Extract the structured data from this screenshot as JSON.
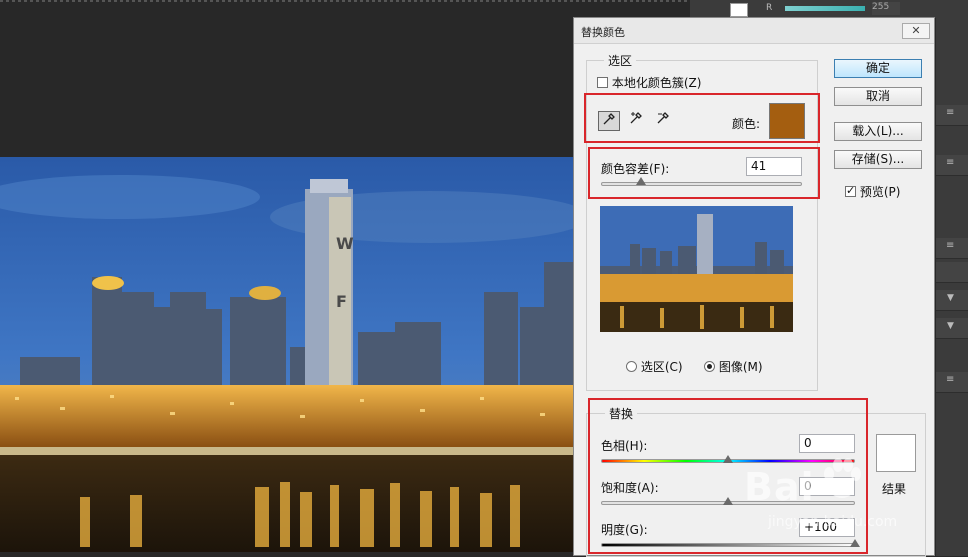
{
  "dialog": {
    "title": "替换颜色",
    "close_label": "✕",
    "selection": {
      "legend": "选区",
      "localized_label": "本地化颜色簇(Z)",
      "localized_checked": false,
      "tools": [
        "eyedropper-icon",
        "eyedropper-plus-icon",
        "eyedropper-minus-icon"
      ],
      "color_label": "颜色:",
      "color_value": "#a45e10",
      "tolerance_label": "颜色容差(F):",
      "tolerance_value": "41",
      "tolerance_level": 0.2,
      "view_selection_label": "选区(C)",
      "view_image_label": "图像(M)",
      "view_selected": "image"
    },
    "replace": {
      "legend": "替换",
      "hue_label": "色相(H):",
      "hue_value": "0",
      "hue_level": 0.5,
      "saturation_label": "饱和度(A):",
      "saturation_value": "0",
      "saturation_level": 0.5,
      "lightness_label": "明度(G):",
      "lightness_value": "+100",
      "lightness_level": 1.0,
      "result_label": "结果",
      "result_color": "#ffffff"
    },
    "buttons": {
      "ok": "确定",
      "cancel": "取消",
      "load": "载入(L)...",
      "save": "存储(S)..."
    },
    "preview_label": "预览(P)",
    "preview_checked": true
  },
  "topbar": {
    "channel_label": "R",
    "channel_value": "255"
  },
  "watermark": {
    "brand": "Bai",
    "domain": "jingyan.baidu.com"
  },
  "colors": {
    "highlight_box": "#d9262b",
    "picked_color": "#a45e10",
    "ok_button_border": "#3c7fb1"
  }
}
